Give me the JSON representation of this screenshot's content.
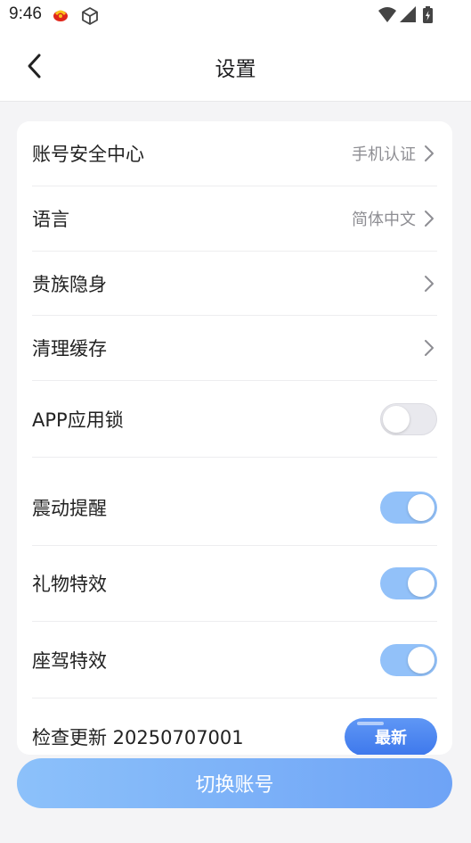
{
  "status_bar": {
    "time": "9:46",
    "icons": [
      "app-logo-icon",
      "cube-icon",
      "wifi-icon",
      "signal-icon",
      "battery-charging-icon"
    ]
  },
  "header": {
    "title": "设置",
    "back_icon": "chevron-left-icon"
  },
  "settings": {
    "account_security": {
      "label": "账号安全中心",
      "value": "手机认证"
    },
    "language": {
      "label": "语言",
      "value": "简体中文"
    },
    "noble_stealth": {
      "label": "贵族隐身"
    },
    "clear_cache": {
      "label": "清理缓存"
    },
    "app_lock": {
      "label": "APP应用锁",
      "enabled": false
    },
    "vibration": {
      "label": "震动提醒",
      "enabled": true
    },
    "gift_effects": {
      "label": "礼物特效",
      "enabled": true
    },
    "mount_effects": {
      "label": "座驾特效",
      "enabled": true
    },
    "check_update": {
      "label": "检查更新 20250707001",
      "badge": "最新"
    }
  },
  "footer": {
    "switch_account": "切换账号"
  },
  "colors": {
    "toggle_on": "#92c1f9",
    "toggle_off": "#e9e9ee",
    "button_gradient_start": "#8cc1fa",
    "button_gradient_end": "#6ea3f6",
    "badge": "#4a83ef"
  }
}
